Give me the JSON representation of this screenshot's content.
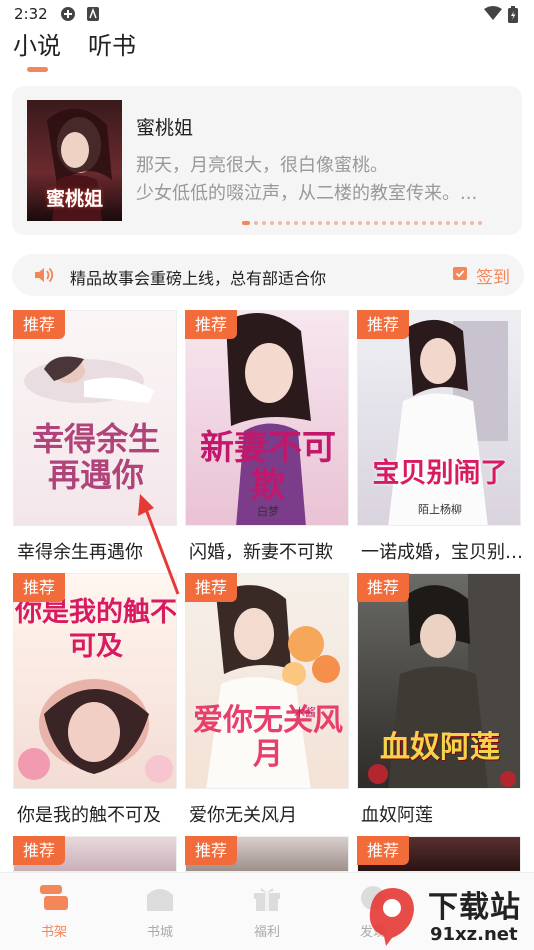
{
  "status": {
    "time": "2:32"
  },
  "tabs": [
    {
      "label": "小说"
    },
    {
      "label": "听书"
    }
  ],
  "featured": {
    "cover_text": "蜜桃姐",
    "title": "蜜桃姐",
    "desc_line1": "那天，月亮很大，很白像蜜桃。",
    "desc_line2": "少女低低的啜泣声，从二楼的教室传来。..."
  },
  "notice": {
    "text": "精品故事会重磅上线，总有部适合你",
    "sign_label": "签到"
  },
  "badge_label": "推荐",
  "books": [
    {
      "title": "幸得余生再遇你",
      "cover_text": "幸得余生再遇你",
      "cover_author": ""
    },
    {
      "title": "闪婚，新妻不可欺",
      "cover_text": "新妻不可欺",
      "cover_author": "白梦"
    },
    {
      "title": "一诺成婚，宝贝别闹了",
      "cover_text": "宝贝别闹了",
      "cover_author": "陌上杨柳"
    },
    {
      "title": "你是我的触不可及",
      "cover_text": "你是我的触不可及",
      "cover_author": ""
    },
    {
      "title": "爱你无关风月",
      "cover_text": "爱你无关风月",
      "cover_author": "木酱"
    },
    {
      "title": "血奴阿莲",
      "cover_text": "血奴阿莲",
      "cover_author": ""
    }
  ],
  "bottom_nav": [
    {
      "label": "书架",
      "icon": "bookshelf-icon"
    },
    {
      "label": "书城",
      "icon": "bookstore-icon"
    },
    {
      "label": "福利",
      "icon": "gift-icon"
    },
    {
      "label": "发现",
      "icon": "discover-icon"
    }
  ],
  "watermark": {
    "brand": "下载站",
    "domain": "91xz.net"
  },
  "colors": {
    "accent": "#f4875a",
    "badge": "#f26b3a",
    "card_bg": "#f5f5f5"
  }
}
